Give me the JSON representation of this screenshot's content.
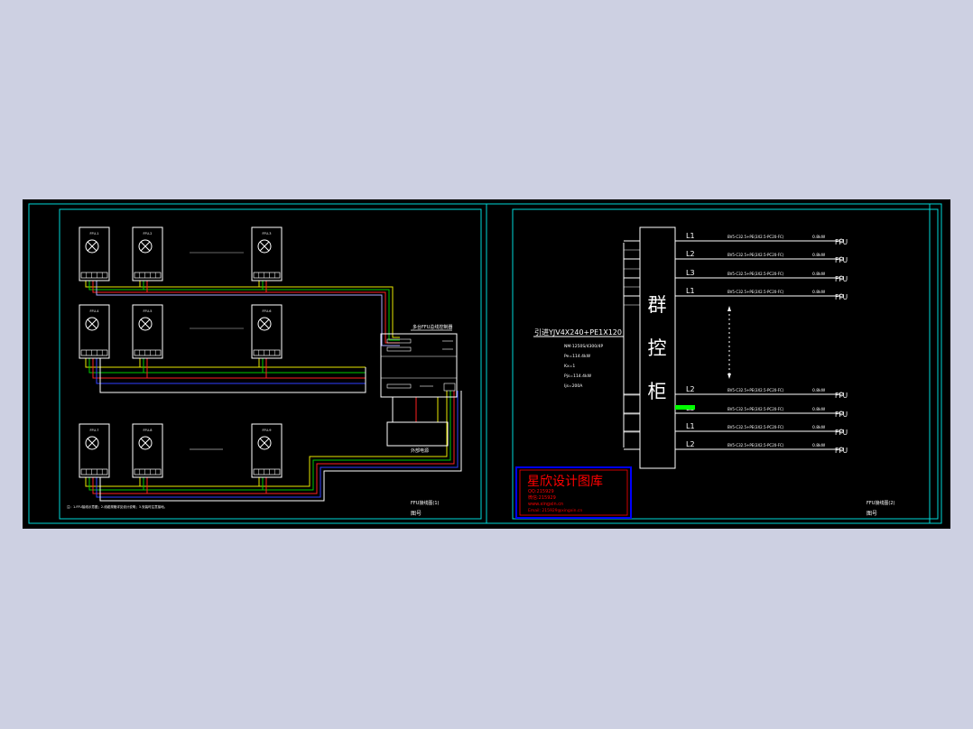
{
  "colors": {
    "background": "#cdd0e2",
    "canvas": "#000000",
    "frame": "#00d8d8",
    "line": "#ffffff",
    "wire_yellow": "#e8e800",
    "wire_green": "#00cc00",
    "wire_red": "#ff2020",
    "wire_blue": "#3040ff",
    "stamp_red": "#ff0000",
    "stamp_blue": "#0000ff",
    "highlight_green": "#00ff00"
  },
  "left_sheet": {
    "fan_units": [
      {
        "id": "FFU-1"
      },
      {
        "id": "FFU-2"
      },
      {
        "id": "FFU-3"
      },
      {
        "id": "FFU-4"
      },
      {
        "id": "FFU-5"
      },
      {
        "id": "FFU-6"
      },
      {
        "id": "FFU-7"
      },
      {
        "id": "FFU-8"
      },
      {
        "id": "FFU-9"
      }
    ],
    "controller_title": "多台FFU总线控制器",
    "power_box_label": "外部电源",
    "footer_note": "注：1.FFU接线示意图；2.线缆规格详见设计说明；3.安装时注意接地。",
    "title_block_name": "FFU接线图(1)",
    "title_block_code": "图号"
  },
  "right_sheet": {
    "cabinet_chars": [
      "群",
      "控",
      "柜"
    ],
    "incoming_cable": "引进YJV4X240+PE1X120",
    "spec_lines": [
      "NM-1250S/4300/4P",
      "Pe=114.4kW",
      "Kx=1",
      "Pjs=114.4kW",
      "Ijs=200A"
    ],
    "circuits": [
      {
        "phase": "L1",
        "cable": "BV5-C32.5+PE(3X2.5-PC20-FC)",
        "power": "0.8kW",
        "load": "FFU"
      },
      {
        "phase": "L2",
        "cable": "BV5-C32.5+PE(3X2.5-PC20-FC)",
        "power": "0.8kW",
        "load": "FFU"
      },
      {
        "phase": "L3",
        "cable": "BV5-C32.5+PE(3X2.5-PC20-FC)",
        "power": "0.8kW",
        "load": "FFU"
      },
      {
        "phase": "L1",
        "cable": "BV5-C32.5+PE(3X2.5-PC20-FC)",
        "power": "0.8kW",
        "load": "FFU"
      },
      {
        "phase": "L2",
        "cable": "BV5-C32.5+PE(3X2.5-PC20-FC)",
        "power": "0.8kW",
        "load": "FFU"
      },
      {
        "phase": "L3",
        "cable": "BV5-C32.5+PE(3X2.5-PC20-FC)",
        "power": "0.8kW",
        "load": "FFU"
      },
      {
        "phase": "L1",
        "cable": "BV5-C32.5+PE(3X2.5-PC20-FC)",
        "power": "0.8kW",
        "load": "FFU"
      },
      {
        "phase": "L2",
        "cable": "BV5-C32.5+PE(3X2.5-PC20-FC)",
        "power": "0.8kW",
        "load": "FFU"
      }
    ],
    "stamp": {
      "title": "星欣设计图库",
      "line1": "QQ:215929",
      "line2": "微信:215929",
      "line3": "www.xingxin.cn",
      "line4": "Email: 215929@xingxin.cn"
    },
    "title_block_name": "FFU接线图(2)",
    "title_block_code": "图号"
  }
}
